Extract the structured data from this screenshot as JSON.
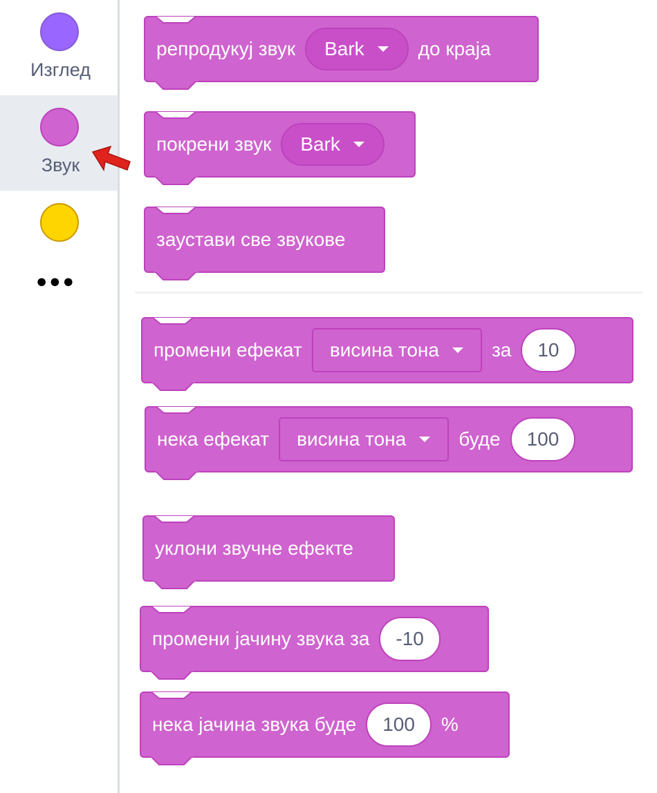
{
  "sidebar": {
    "categories": [
      {
        "label": "Изглед",
        "color": "#9966ff",
        "border": "#855cd6"
      },
      {
        "label": "Звук",
        "color": "#cf63cf",
        "border": "#bd42bd"
      },
      {
        "label": "",
        "color": "#ffd500",
        "border": "#cc9900"
      }
    ],
    "more": "●●●",
    "selected_index": 1
  },
  "colors": {
    "block": "#cf63cf",
    "block_border": "#bd42bd",
    "highlight_arrow": "#e0231c"
  },
  "blocks": {
    "play_until_done": {
      "text_before": "репродукуј звук",
      "sound": "Bark",
      "text_after": "до краја"
    },
    "start_sound": {
      "text_before": "покрени звук",
      "sound": "Bark"
    },
    "stop_all": {
      "text": "заустави све звукове"
    },
    "change_effect": {
      "text_before": "промени ефекат",
      "effect": "висина тона",
      "text_mid": "за",
      "value": "10"
    },
    "set_effect": {
      "text_before": "нека ефекат",
      "effect": "висина тона",
      "text_mid": "буде",
      "value": "100"
    },
    "clear_effects": {
      "text": "уклони звучне ефекте"
    },
    "change_volume": {
      "text_before": "промени јачину звука за",
      "value": "-10"
    },
    "set_volume": {
      "text_before": "нека јачина звука буде",
      "value": "100",
      "text_after": "%"
    }
  }
}
